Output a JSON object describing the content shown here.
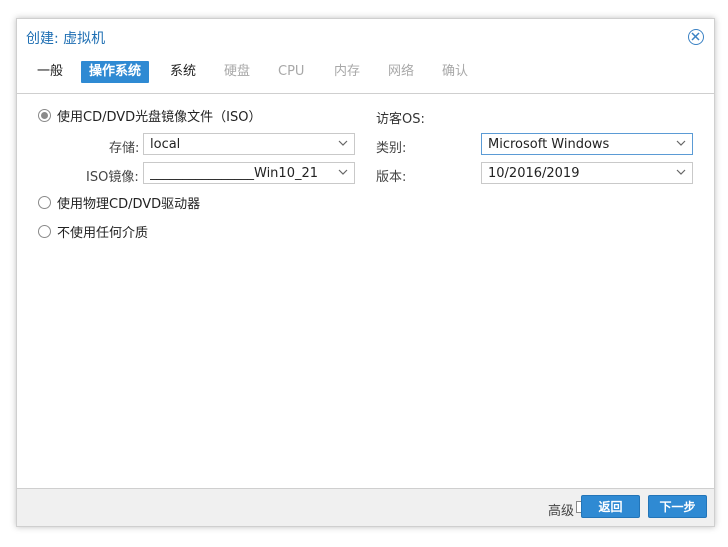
{
  "window": {
    "title": "创建: 虚拟机"
  },
  "tabs": [
    {
      "label": "一般",
      "state": "normal"
    },
    {
      "label": "操作系统",
      "state": "active"
    },
    {
      "label": "系统",
      "state": "normal"
    },
    {
      "label": "硬盘",
      "state": "disabled"
    },
    {
      "label": "CPU",
      "state": "disabled"
    },
    {
      "label": "内存",
      "state": "disabled"
    },
    {
      "label": "网络",
      "state": "disabled"
    },
    {
      "label": "确认",
      "state": "disabled"
    }
  ],
  "media": {
    "use_iso_label": "使用CD/DVD光盘镜像文件（ISO）",
    "storage_label": "存储:",
    "storage_value": "local",
    "iso_label": "ISO镜像:",
    "iso_value": "________________Win10_21",
    "physical_label": "使用物理CD/DVD驱动器",
    "none_label": "不使用任何介质"
  },
  "guest_os": {
    "heading": "访客OS:",
    "type_label": "类别:",
    "type_value": "Microsoft Windows",
    "version_label": "版本:",
    "version_value": "10/2016/2019"
  },
  "footer": {
    "advanced_label": "高级",
    "back_label": "返回",
    "next_label": "下一步"
  },
  "colors": {
    "accent": "#2f8ad3",
    "title": "#1f6fb3"
  }
}
